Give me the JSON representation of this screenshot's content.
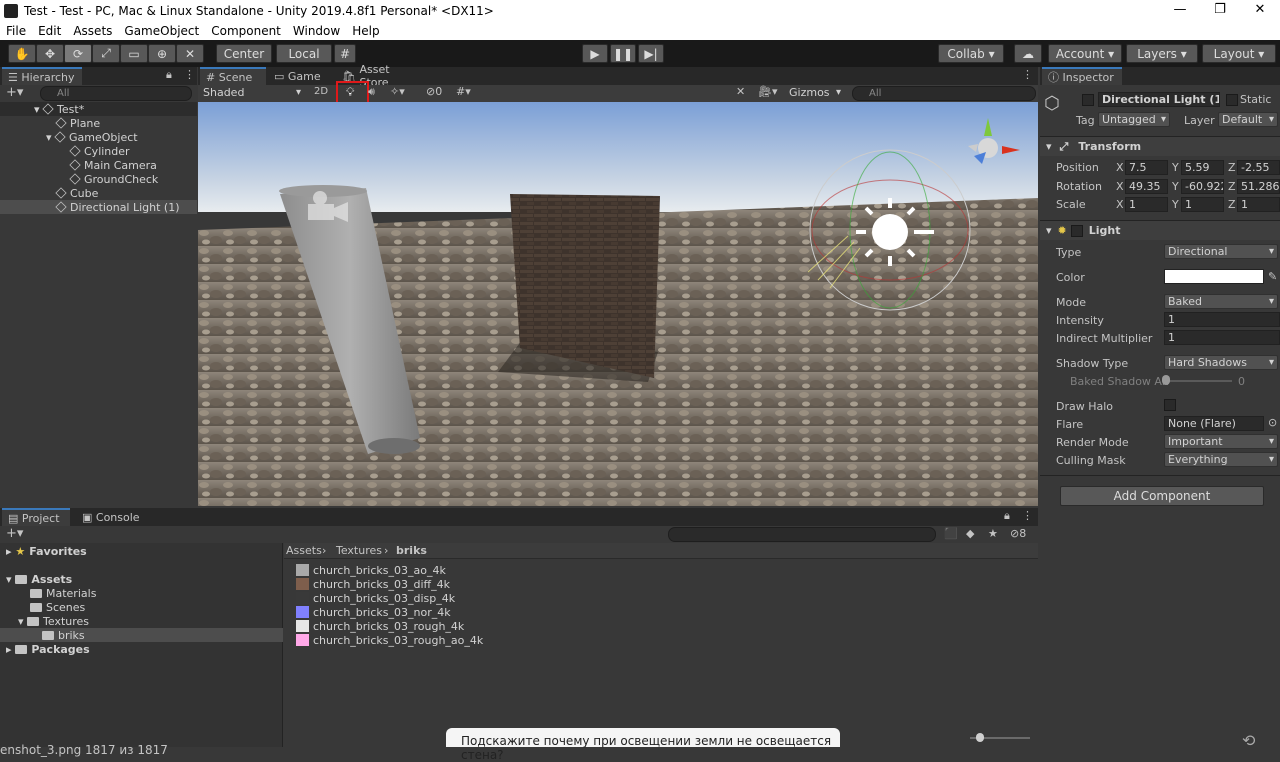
{
  "window": {
    "title": "Test - Test - PC, Mac & Linux Standalone - Unity 2019.4.8f1 Personal* <DX11>"
  },
  "menu": [
    "File",
    "Edit",
    "Assets",
    "GameObject",
    "Component",
    "Window",
    "Help"
  ],
  "toolbar": {
    "center": "Center",
    "local": "Local",
    "collab": "Collab",
    "account": "Account",
    "layers": "Layers",
    "layout": "Layout"
  },
  "hierarchy": {
    "tab": "Hierarchy",
    "search_placeholder": "All",
    "scene": "Test*",
    "items": [
      "Plane",
      "GameObject",
      "Cylinder",
      "Main Camera",
      "GroundCheck",
      "Cube",
      "Directional Light (1)"
    ]
  },
  "scene": {
    "tabs": [
      "Scene",
      "Game",
      "Asset Store"
    ],
    "shading": "Shaded",
    "mode_2d": "2D",
    "hidden_count": "0",
    "gizmos": "Gizmos",
    "search_placeholder": "All"
  },
  "inspector": {
    "tab": "Inspector",
    "object_name": "Directional Light (1)",
    "static_label": "Static",
    "tag_label": "Tag",
    "tag_value": "Untagged",
    "layer_label": "Layer",
    "layer_value": "Default",
    "transform": {
      "title": "Transform",
      "position_label": "Position",
      "rotation_label": "Rotation",
      "scale_label": "Scale",
      "position": [
        "7.5",
        "5.59",
        "-2.55"
      ],
      "rotation": [
        "49.35",
        "-60.922",
        "51.286"
      ],
      "scale": [
        "1",
        "1",
        "1"
      ]
    },
    "light": {
      "title": "Light",
      "type_label": "Type",
      "type_value": "Directional",
      "color_label": "Color",
      "color_value": "#ffffff",
      "mode_label": "Mode",
      "mode_value": "Baked",
      "intensity_label": "Intensity",
      "intensity_value": "1",
      "indirect_label": "Indirect Multiplier",
      "indirect_value": "1",
      "shadow_type_label": "Shadow Type",
      "shadow_type_value": "Hard Shadows",
      "baked_shadow_label": "Baked Shadow An",
      "baked_shadow_value": "0",
      "draw_halo_label": "Draw Halo",
      "flare_label": "Flare",
      "flare_value": "None (Flare)",
      "render_mode_label": "Render Mode",
      "render_mode_value": "Important",
      "culling_mask_label": "Culling Mask",
      "culling_mask_value": "Everything"
    },
    "add_component": "Add Component"
  },
  "project": {
    "tabs": [
      "Project",
      "Console"
    ],
    "hidden_count": "8",
    "tree": {
      "favorites": "Favorites",
      "assets": "Assets",
      "materials": "Materials",
      "scenes": "Scenes",
      "textures": "Textures",
      "briks": "briks",
      "packages": "Packages"
    },
    "breadcrumb": [
      "Assets",
      "Textures",
      "briks"
    ],
    "files": [
      {
        "name": "church_bricks_03_ao_4k",
        "color": "#a9a9a9"
      },
      {
        "name": "church_bricks_03_diff_4k",
        "color": "#7e5e4c"
      },
      {
        "name": "church_bricks_03_disp_4k",
        "color": "#393939"
      },
      {
        "name": "church_bricks_03_nor_4k",
        "color": "#8080ff"
      },
      {
        "name": "church_bricks_03_rough_4k",
        "color": "#e6e6e6"
      },
      {
        "name": "church_bricks_03_rough_ao_4k",
        "color": "#ffa8e8"
      }
    ]
  },
  "overlay": {
    "image_caption": "enshot_3.png 1817 из 1817",
    "question": "Подскажите почему при освещении земли не освещается стена?"
  },
  "colors": {
    "accent": "#3a79bb",
    "highlight": "#e0191a"
  }
}
